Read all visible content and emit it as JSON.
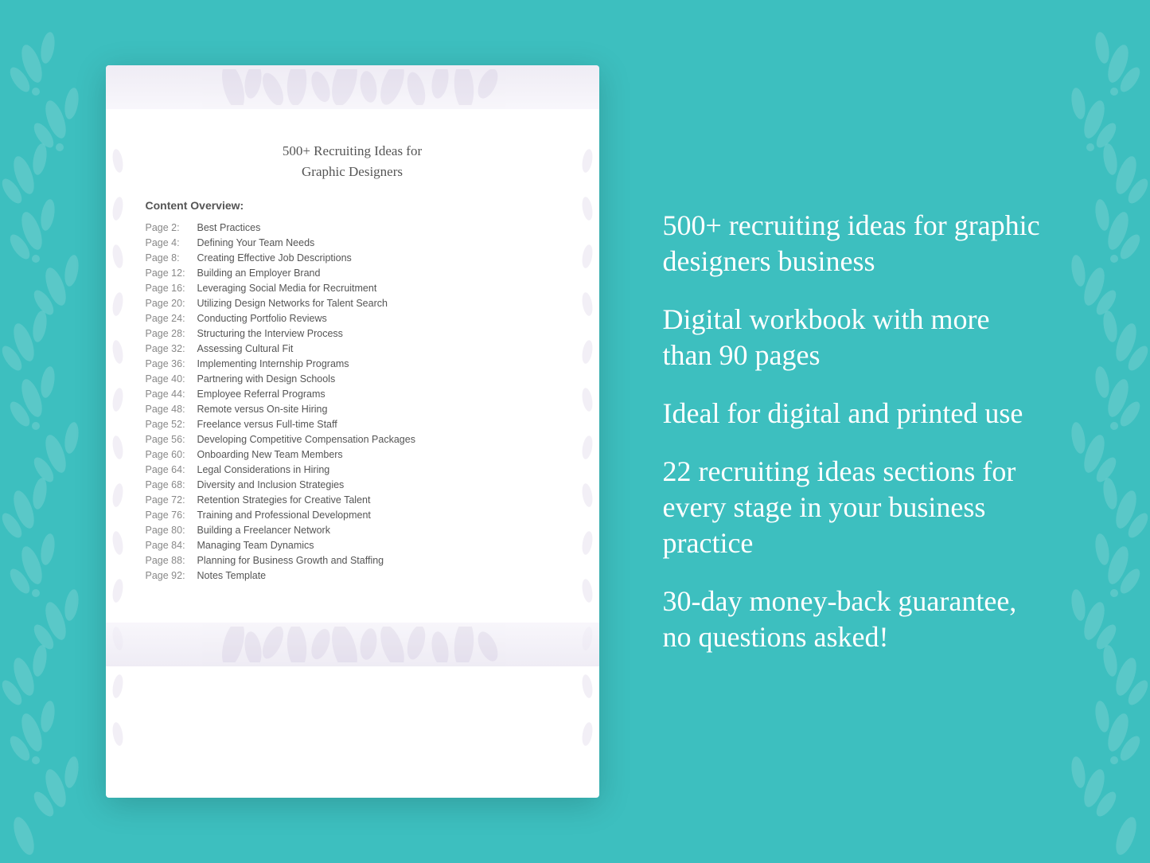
{
  "background": {
    "color": "#3dbfbf"
  },
  "document": {
    "title_line1": "500+ Recruiting Ideas for",
    "title_line2": "Graphic Designers",
    "overview_label": "Content Overview:",
    "toc_items": [
      {
        "page": "Page  2:",
        "title": "Best Practices"
      },
      {
        "page": "Page  4:",
        "title": "Defining Your Team Needs"
      },
      {
        "page": "Page  8:",
        "title": "Creating Effective Job Descriptions"
      },
      {
        "page": "Page 12:",
        "title": "Building an Employer Brand"
      },
      {
        "page": "Page 16:",
        "title": "Leveraging Social Media for Recruitment"
      },
      {
        "page": "Page 20:",
        "title": "Utilizing Design Networks for Talent Search"
      },
      {
        "page": "Page 24:",
        "title": "Conducting Portfolio Reviews"
      },
      {
        "page": "Page 28:",
        "title": "Structuring the Interview Process"
      },
      {
        "page": "Page 32:",
        "title": "Assessing Cultural Fit"
      },
      {
        "page": "Page 36:",
        "title": "Implementing Internship Programs"
      },
      {
        "page": "Page 40:",
        "title": "Partnering with Design Schools"
      },
      {
        "page": "Page 44:",
        "title": "Employee Referral Programs"
      },
      {
        "page": "Page 48:",
        "title": "Remote versus On-site Hiring"
      },
      {
        "page": "Page 52:",
        "title": "Freelance versus Full-time Staff"
      },
      {
        "page": "Page 56:",
        "title": "Developing Competitive Compensation Packages"
      },
      {
        "page": "Page 60:",
        "title": "Onboarding New Team Members"
      },
      {
        "page": "Page 64:",
        "title": "Legal Considerations in Hiring"
      },
      {
        "page": "Page 68:",
        "title": "Diversity and Inclusion Strategies"
      },
      {
        "page": "Page 72:",
        "title": "Retention Strategies for Creative Talent"
      },
      {
        "page": "Page 76:",
        "title": "Training and Professional Development"
      },
      {
        "page": "Page 80:",
        "title": "Building a Freelancer Network"
      },
      {
        "page": "Page 84:",
        "title": "Managing Team Dynamics"
      },
      {
        "page": "Page 88:",
        "title": "Planning for Business Growth and Staffing"
      },
      {
        "page": "Page 92:",
        "title": "Notes Template"
      }
    ]
  },
  "features": [
    {
      "text": "500+ recruiting ideas for graphic designers business"
    },
    {
      "text": "Digital workbook with more than 90 pages"
    },
    {
      "text": "Ideal for digital and printed use"
    },
    {
      "text": "22 recruiting ideas sections for every stage in your business practice"
    },
    {
      "text": "30-day money-back guarantee, no questions asked!"
    }
  ]
}
